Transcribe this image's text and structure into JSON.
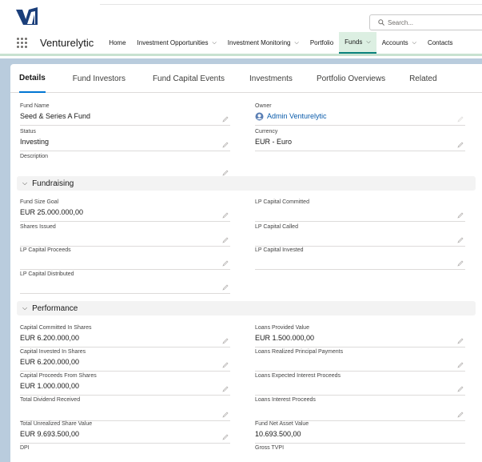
{
  "header": {
    "search_placeholder": "Search...",
    "app_name": "Venturelytic",
    "nav": [
      {
        "label": "Home",
        "dropdown": false
      },
      {
        "label": "Investment Opportunities",
        "dropdown": true
      },
      {
        "label": "Investment Monitoring",
        "dropdown": true
      },
      {
        "label": "Portfolio",
        "dropdown": false
      },
      {
        "label": "Funds",
        "dropdown": true,
        "active": true
      },
      {
        "label": "Accounts",
        "dropdown": true
      },
      {
        "label": "Contacts",
        "dropdown": false
      }
    ],
    "chevron": "⌵"
  },
  "tabs": [
    "Details",
    "Fund Investors",
    "Fund Capital Events",
    "Investments",
    "Portfolio Overviews",
    "Related"
  ],
  "details": {
    "fund_name_label": "Fund Name",
    "fund_name": "Seed & Series A Fund",
    "owner_label": "Owner",
    "owner": "Admin Venturelytic",
    "status_label": "Status",
    "status": "Investing",
    "currency_label": "Currency",
    "currency": "EUR - Euro",
    "description_label": "Description",
    "description": ""
  },
  "fundraising": {
    "title": "Fundraising",
    "fund_size_goal_label": "Fund Size Goal",
    "fund_size_goal": "EUR 25.000.000,00",
    "lp_committed_label": "LP Capital Committed",
    "lp_committed": "",
    "shares_issued_label": "Shares Issued",
    "shares_issued": "",
    "lp_called_label": "LP Capital Called",
    "lp_called": "",
    "lp_proceeds_label": "LP Capital Proceeds",
    "lp_proceeds": "",
    "lp_invested_label": "LP Capital Invested",
    "lp_invested": "",
    "lp_distributed_label": "LP Capital Distributed",
    "lp_distributed": ""
  },
  "performance": {
    "title": "Performance",
    "cap_committed_shares_label": "Capital Committed In Shares",
    "cap_committed_shares": "EUR 6.200.000,00",
    "loans_provided_label": "Loans Provided Value",
    "loans_provided": "EUR 1.500.000,00",
    "cap_invested_shares_label": "Capital Invested In Shares",
    "cap_invested_shares": "EUR 6.200.000,00",
    "loans_realized_label": "Loans Realized Principal Payments",
    "loans_realized": "",
    "cap_proceeds_shares_label": "Capital Proceeds From Shares",
    "cap_proceeds_shares": "EUR 1.000.000,00",
    "loans_expected_label": "Loans Expected Interest Proceeds",
    "loans_expected": "",
    "total_dividend_label": "Total Dividend Received",
    "total_dividend": "",
    "loans_interest_label": "Loans Interest Proceeds",
    "loans_interest": "",
    "unrealized_label": "Total Unrealized Share Value",
    "unrealized": "EUR 9.693.500,00",
    "nav_label": "Fund Net Asset Value",
    "nav": "10.693.500,00",
    "dpi_label": "DPI",
    "dpi": "",
    "gross_tvpi_label": "Gross TVPI",
    "gross_tvpi": ""
  },
  "colors": {
    "brand_blue": "#0176d3",
    "active_tab_bg": "#dcefe2",
    "band": "#b9ccdd"
  }
}
